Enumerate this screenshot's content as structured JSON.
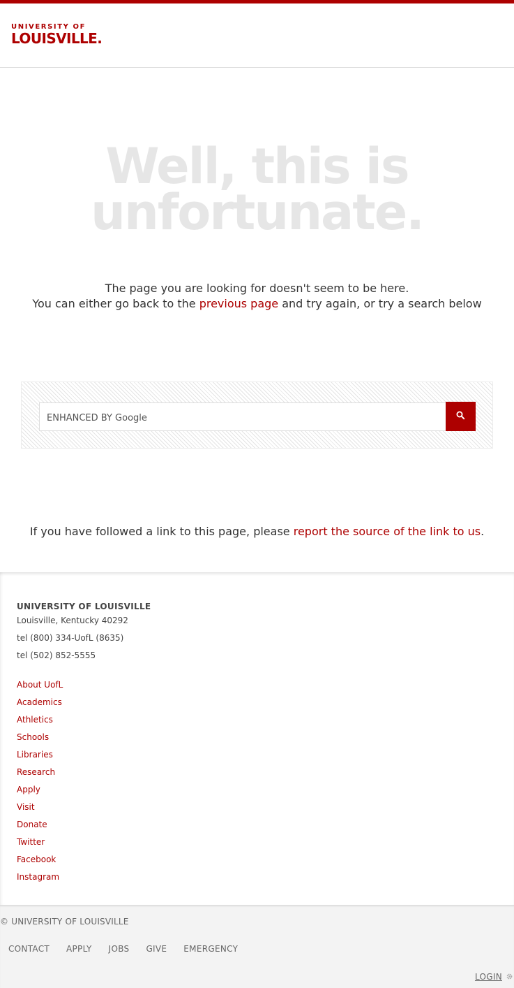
{
  "header": {
    "logo_top": "UNIVERSITY OF",
    "logo_bottom": "LOUISVILLE."
  },
  "headline": {
    "line1": "Well, this is",
    "line2": "unfortunate."
  },
  "message": {
    "line1": "The page you are looking for doesn't seem to be here.",
    "line2_before": "You can either go back to the",
    "line2_link": "previous page",
    "line2_after": "and try again, or try a search below"
  },
  "search": {
    "placeholder": "ENHANCED BY Google",
    "button_icon": "search-icon"
  },
  "report": {
    "before": "If you have followed a link to this page, please",
    "link": "report the source of the link to us",
    "after": "."
  },
  "footer": {
    "title": "UNIVERSITY OF LOUISVILLE",
    "address": "Louisville, Kentucky 40292",
    "tel1": "tel (800) 334-UofL (8635)",
    "tel2": "tel (502) 852-5555",
    "links": [
      "About UofL",
      "Academics",
      "Athletics",
      "Schools",
      "Libraries",
      "Research",
      "Apply",
      "Visit",
      "Donate",
      "Twitter",
      "Facebook",
      "Instagram"
    ]
  },
  "bottom": {
    "copyright": "© UNIVERSITY OF LOUISVILLE",
    "nav": [
      "CONTACT",
      "APPLY",
      "JOBS",
      "GIVE",
      "EMERGENCY"
    ],
    "login": "LOGIN",
    "login_icon": "gear-icon"
  },
  "colors": {
    "brand": "#ad0000",
    "headline": "#e6e6e6"
  }
}
